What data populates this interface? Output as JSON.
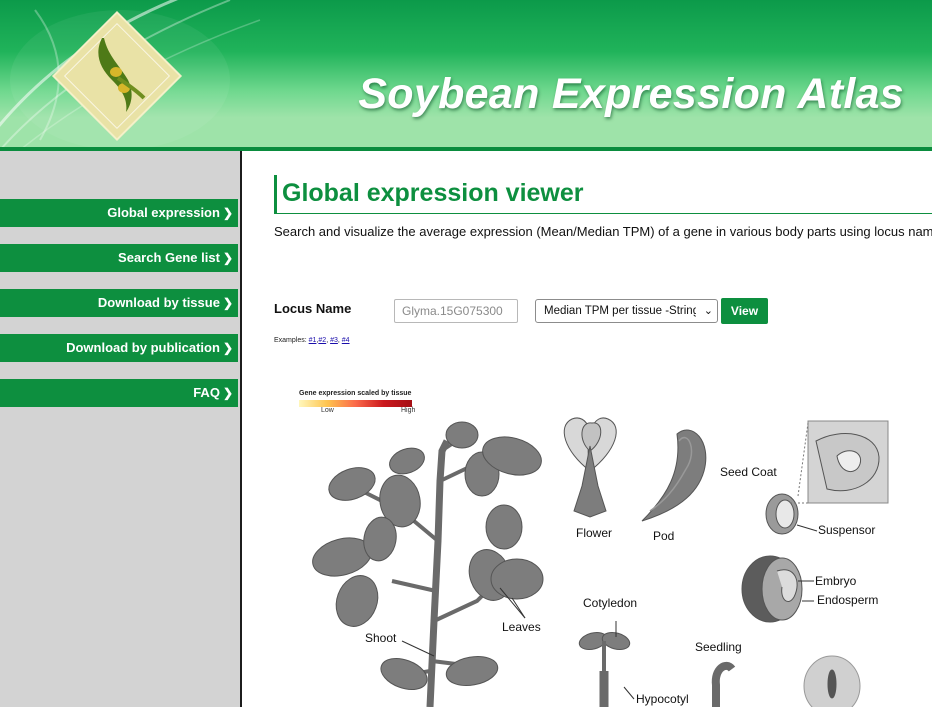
{
  "header": {
    "title": "Soybean Expression Atlas",
    "logo_icon": "soybean-pod-logo-icon",
    "colors": {
      "green_dark": "#0c9a4a",
      "green_light": "#9ee3a9"
    }
  },
  "sidebar": {
    "items": [
      {
        "label": "Global expression",
        "icon": "chevron-right-icon"
      },
      {
        "label": "Search Gene list",
        "icon": "chevron-right-icon"
      },
      {
        "label": "Download by tissue",
        "icon": "chevron-right-icon"
      },
      {
        "label": "Download by publication",
        "icon": "chevron-right-icon"
      },
      {
        "label": "FAQ",
        "icon": "chevron-right-icon"
      }
    ],
    "chevron": "❯"
  },
  "main": {
    "title": "Global expression viewer",
    "description": "Search and visualize the average expression (Mean/Median TPM) of a gene in various body parts using locus name",
    "locus_label": "Locus Name",
    "locus_placeholder": "Glyma.15G075300",
    "select_value": "Median TPM per tissue -StringTie",
    "view_button": "View",
    "examples_label": "Examples:",
    "examples": [
      "#1",
      "#2",
      "#3",
      "#4"
    ]
  },
  "legend": {
    "title": "Gene expression scaled by tissue",
    "low": "Low",
    "high": "High",
    "colors": [
      "#fff7bc",
      "#fec44f",
      "#fb6a4a",
      "#cb181d",
      "#a50f15"
    ]
  },
  "diagram": {
    "labels": {
      "flower": "Flower",
      "pod": "Pod",
      "seed_coat": "Seed Coat",
      "suspensor": "Suspensor",
      "embryo": "Embryo",
      "endosperm": "Endosperm",
      "cotyledon": "Cotyledon",
      "seedling": "Seedling",
      "hypocotyl": "Hypocotyl",
      "leaves": "Leaves",
      "shoot": "Shoot"
    },
    "tissue_color": "#7d7d7d"
  }
}
